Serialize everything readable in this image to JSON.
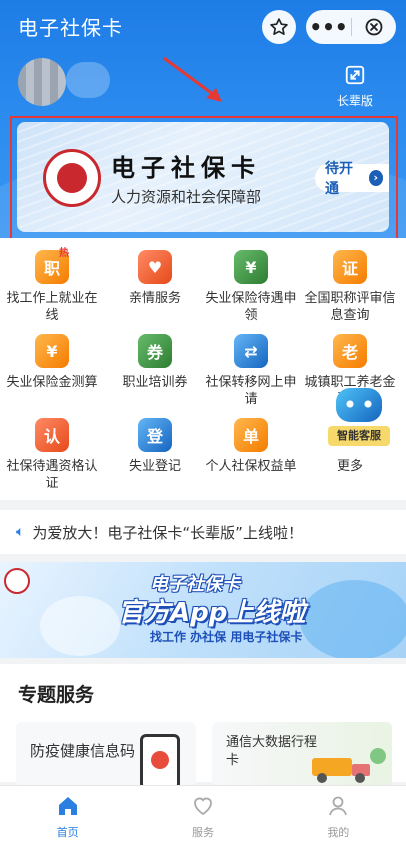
{
  "app": {
    "title": "电子社保卡"
  },
  "header": {
    "star_icon": "star-icon",
    "more_icon": "more-dots-icon",
    "close_icon": "close-icon",
    "elder_mode_label": "长辈版",
    "elder_mode_icon": "elder-mode-icon"
  },
  "card": {
    "title": "电子社保卡",
    "subtitle": "人力资源和社会保障部",
    "activate_label": "待开通",
    "highlight_color": "#e53935"
  },
  "services": [
    {
      "label": "找工作上就业在线",
      "icon": "job-search-icon",
      "color": "orange",
      "badge": "热"
    },
    {
      "label": "亲情服务",
      "icon": "family-heart-icon",
      "color": "red"
    },
    {
      "label": "失业保险待遇申领",
      "icon": "unemployment-benefit-icon",
      "color": "green"
    },
    {
      "label": "全国职称评审信息查询",
      "icon": "title-review-icon",
      "color": "orange"
    },
    {
      "label": "失业保险金测算",
      "icon": "calculator-icon",
      "color": "orange"
    },
    {
      "label": "职业培训券",
      "icon": "training-voucher-icon",
      "color": "green"
    },
    {
      "label": "社保转移网上申请",
      "icon": "transfer-icon",
      "color": "blue"
    },
    {
      "label": "城镇职工养老金测算",
      "icon": "pension-icon",
      "color": "orange"
    },
    {
      "label": "社保待遇资格认证",
      "icon": "certification-icon",
      "color": "red"
    },
    {
      "label": "失业登记",
      "icon": "registration-icon",
      "color": "blue"
    },
    {
      "label": "个人社保权益单",
      "icon": "rights-sheet-icon",
      "color": "orange"
    },
    {
      "label": "更多",
      "icon": "more-icon",
      "color": "none"
    }
  ],
  "assistant": {
    "label": "智能客服"
  },
  "notice": {
    "text": "为爱放大！电子社保卡“长辈版”上线啦！"
  },
  "banner": {
    "line1": "电子社保卡",
    "line2": "官方App上线啦",
    "line3": "找工作 办社保 用电子社保卡"
  },
  "special": {
    "heading": "专题服务",
    "items": [
      {
        "label": "防疫健康信息码"
      },
      {
        "label": "通信大数据行程卡"
      }
    ]
  },
  "tabbar": {
    "active_color": "#2a7fe0",
    "tabs": [
      {
        "label": "首页",
        "icon": "home-icon",
        "active": true
      },
      {
        "label": "服务",
        "icon": "heart-service-icon",
        "active": false
      },
      {
        "label": "我的",
        "icon": "profile-icon",
        "active": false
      }
    ]
  }
}
